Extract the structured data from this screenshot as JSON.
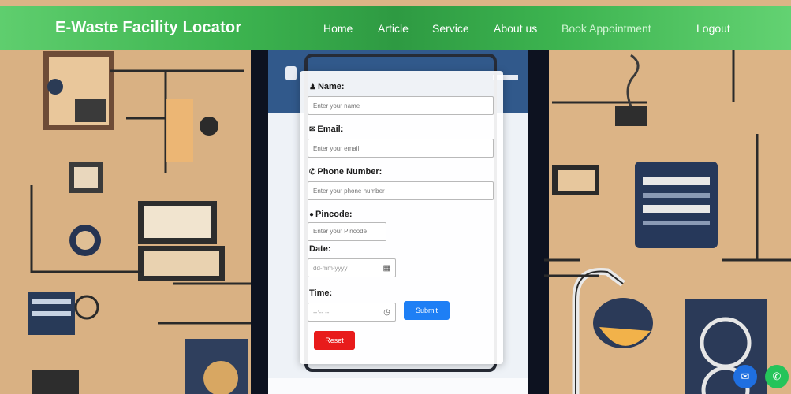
{
  "brand": "E-Waste Facility Locator",
  "nav": {
    "home": "Home",
    "article": "Article",
    "service": "Service",
    "about": "About us",
    "book": "Book Appointment",
    "logout": "Logout"
  },
  "form": {
    "name_label": "Name:",
    "name_placeholder": "Enter your name",
    "email_label": "Email:",
    "email_placeholder": "Enter your email",
    "phone_label": "Phone Number:",
    "phone_placeholder": "Enter your phone number",
    "pincode_label": "Pincode:",
    "pincode_placeholder": "Enter your Pincode",
    "date_label": "Date:",
    "date_placeholder": "dd-mm-yyyy",
    "time_label": "Time:",
    "time_placeholder": "--:-- --",
    "submit_label": "Submit",
    "reset_label": "Reset"
  },
  "colors": {
    "navbar": "#3cb34f",
    "submit": "#1e7ff5",
    "reset": "#e81b1b",
    "mail_fab": "#1f6fe0",
    "whatsapp_fab": "#25c45a"
  },
  "icons": {
    "name": "user-icon",
    "email": "envelope-icon",
    "phone": "phone-icon",
    "pincode": "map-marker-icon",
    "date": "calendar-icon",
    "time": "clock-icon",
    "mail_fab": "mail-icon",
    "whatsapp_fab": "whatsapp-icon"
  }
}
